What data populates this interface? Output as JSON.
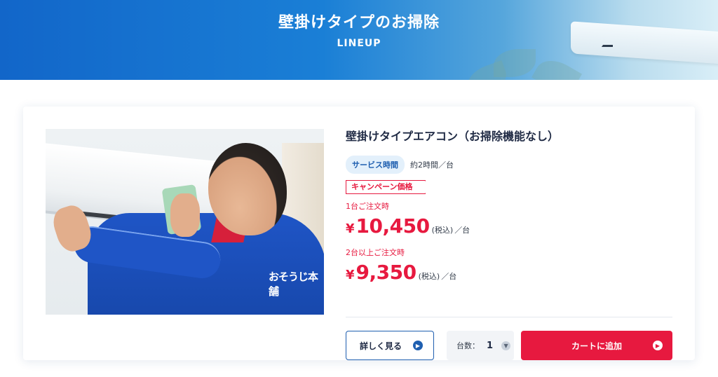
{
  "hero": {
    "title": "壁掛けタイプのお掃除",
    "subtitle": "LINEUP"
  },
  "product": {
    "photo_caption": "おそうじ本舗",
    "title": "壁掛けタイプエアコン（お掃除機能なし）",
    "service_time_label": "サービス時間",
    "service_time_value": "約2時間／台",
    "campaign_label": "キャンペーン価格",
    "tiers": [
      {
        "note": "1台ご注文時",
        "yen": "¥",
        "price": "10,450",
        "tax": "(税込)",
        "unit": "／台"
      },
      {
        "note": "2台以上ご注文時",
        "yen": "¥",
        "price": "9,350",
        "tax": "(税込)",
        "unit": "／台"
      }
    ]
  },
  "actions": {
    "detail_label": "詳しく見る",
    "qty_label": "台数：",
    "qty_value": "1",
    "cart_label": "カートに追加"
  },
  "colors": {
    "brand_blue": "#1f5fb0",
    "accent_red": "#e7193f",
    "hero_start": "#1266c9"
  },
  "icons": {
    "detail_arrow": "chevron-right",
    "qty_dropdown": "chevron-down",
    "cart_arrow": "chevron-right"
  }
}
